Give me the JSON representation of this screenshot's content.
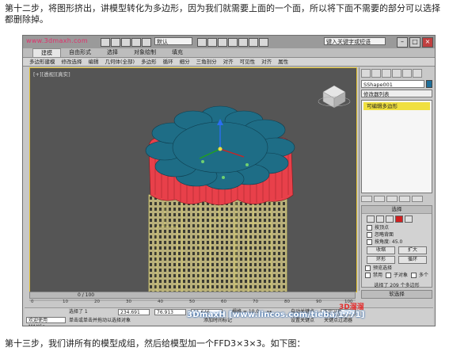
{
  "paragraphs": {
    "top": "第十二步，将图形挤出，讲模型转化为多边形，因为我们就需要上面的一个面，所以将下面不需要的部分可以选择都删除掉。",
    "bottom": "第十三步，我们讲所有的模型成组，然后给模型加一个FFD3×3×3。如下图："
  },
  "app": {
    "brand": "www.3dmaxh.com",
    "workspace": "默认",
    "search_placeholder": "键入关键字或短语",
    "ribbon_tabs": [
      "建模",
      "自由形式",
      "选择",
      "对象绘制",
      "填充"
    ],
    "active_tab": 0,
    "ribbon_cmds": [
      "多边形建模",
      "修改选择",
      "编辑",
      "几何体(全部)",
      "多边形",
      "循环",
      "细分",
      "三角剖分",
      "对齐",
      "可见性",
      "对齐",
      "属性"
    ],
    "viewport_label": "[+][透视][真实]"
  },
  "command_panel": {
    "object_name": "SShape001",
    "modifier_list": "修改器列表",
    "stack_item": "可编辑多边形",
    "selection_title": "选择",
    "checkboxes": [
      "按顶点",
      "忽略背面",
      "按角度: 45.0"
    ],
    "shrink": "收缩",
    "grow": "扩大",
    "ring": "环形",
    "loop": "循环",
    "preview_label": "预览选择",
    "preview_options": [
      "禁用",
      "子对象",
      "多个"
    ],
    "selection_info": "选择了 209 个多边形",
    "soft_selection": "软选择",
    "edit_polygons": "编辑多边形",
    "insert_vertex": "插入顶点"
  },
  "bottom": {
    "time_label": "0 / 100",
    "ruler_ticks": [
      "0",
      "10",
      "20",
      "30",
      "40",
      "50",
      "60",
      "70",
      "80",
      "90",
      "100"
    ],
    "selected": "选择了 1",
    "x": "234.691",
    "y": "76.913",
    "z": "11.646",
    "grid": "栅格 = 10.0",
    "auto_key": "自动关键点",
    "set_key": "设置关键点",
    "selected_obj": "选定对象",
    "key_filter": "关键点过滤器",
    "status_hint": "单击或单击并拖动以选择对象",
    "add_time_tag": "添加时间标记",
    "welcome": "欢迎使用 MAXSc"
  },
  "watermark": "3DmaxH  [www.lincos.com/tieba/1771]",
  "corner_logo": "3D溜溜",
  "colors": {
    "flower_top": "#1e6d86",
    "flower_side": "#e8404a",
    "cylinders": "#c8bf86",
    "viewport_bg": "#555555",
    "stack_highlight": "#f0e040"
  }
}
